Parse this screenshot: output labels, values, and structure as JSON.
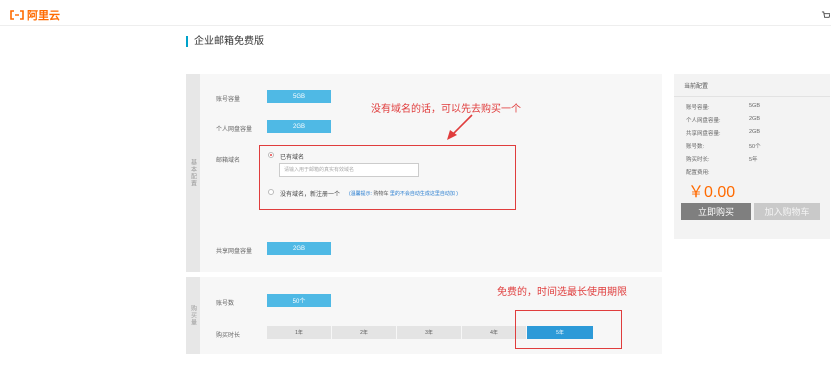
{
  "header": {
    "logo_text": "阿里云",
    "brand_color": "#ff6a00"
  },
  "page": {
    "title": "企业邮箱免费版"
  },
  "basic_section": {
    "side_label": "基本配置",
    "rows": {
      "account_capacity": {
        "label": "账号容量",
        "value": "5GB"
      },
      "personal_disk": {
        "label": "个人网盘容量",
        "value": "2GB"
      },
      "shared_disk": {
        "label": "共享网盘容量",
        "value": "2GB"
      }
    },
    "domain": {
      "label": "邮箱域名",
      "option_existing": "已有域名",
      "input_placeholder": "请输入用于邮箱的真实有效域名",
      "option_new": "没有域名，新注册一个",
      "hint_prefix": "(温馨提示:",
      "hint_link": "购物车",
      "hint_suffix": "里的不会自动生成这里自动加 )"
    }
  },
  "buy_section": {
    "side_label": "购买量",
    "accounts": {
      "label": "账号数",
      "value": "50个"
    },
    "duration": {
      "label": "购买时长",
      "options": [
        "1年",
        "2年",
        "3年",
        "4年",
        "5年"
      ],
      "selected": "5年"
    }
  },
  "summary": {
    "title": "当前配置",
    "rows": [
      {
        "label": "账号容量:",
        "value": "5GB"
      },
      {
        "label": "个人网盘容量:",
        "value": "2GB"
      },
      {
        "label": "共享网盘容量:",
        "value": "2GB"
      },
      {
        "label": "账号数:",
        "value": "50个"
      },
      {
        "label": "购买时长:",
        "value": "5年"
      },
      {
        "label": "配置费用:",
        "value": ""
      }
    ],
    "price": "￥0.00",
    "buy_button": "立即购买",
    "cart_button": "加入购物车"
  },
  "annotations": {
    "domain_note": "没有域名的话，可以先去购买一个",
    "duration_note": "免费的，时间选最长使用期限",
    "annotation_color": "#e03d3d"
  }
}
